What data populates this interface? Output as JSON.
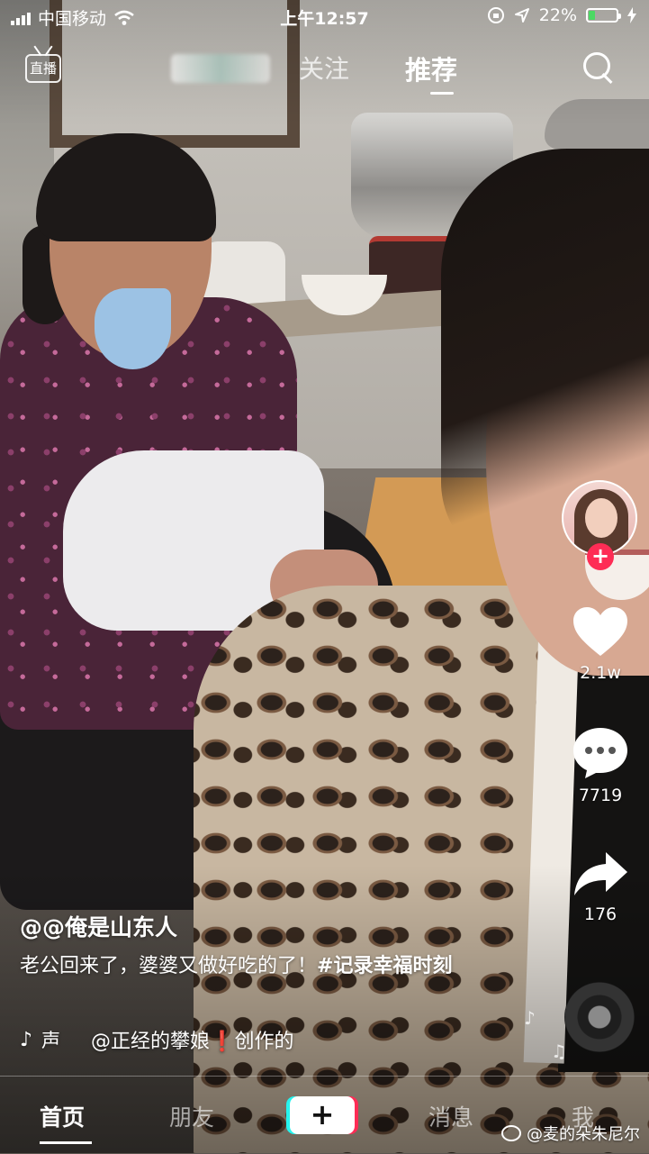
{
  "status_bar": {
    "carrier": "中国移动",
    "time": "上午12:57",
    "battery_percent": "22%",
    "battery_level": 0.22,
    "battery_color": "#4cd964"
  },
  "top_nav": {
    "live_label": "直播",
    "follow_tab": "关注",
    "recommend_tab": "推荐",
    "search_icon": "search-icon"
  },
  "video": {
    "author": "@@俺是山东人",
    "description": "老公回来了，婆婆又做好吃的了！",
    "hashtag": "#记录幸福时刻",
    "sound_prefix": "声",
    "sound_credit": "@正经的攀娘",
    "sound_mark": "❗",
    "sound_suffix": "创作的"
  },
  "rail": {
    "follow_plus": "+",
    "like_count": "2.1w",
    "comment_count": "7719",
    "share_count": "176"
  },
  "bottom_nav": {
    "home": "首页",
    "friends": "朋友",
    "add": "+",
    "messages": "消息",
    "me": "我"
  },
  "watermark": "@麦的朵朱尼尔",
  "colors": {
    "accent_red": "#fe2c55",
    "accent_cyan": "#25f4ee"
  }
}
